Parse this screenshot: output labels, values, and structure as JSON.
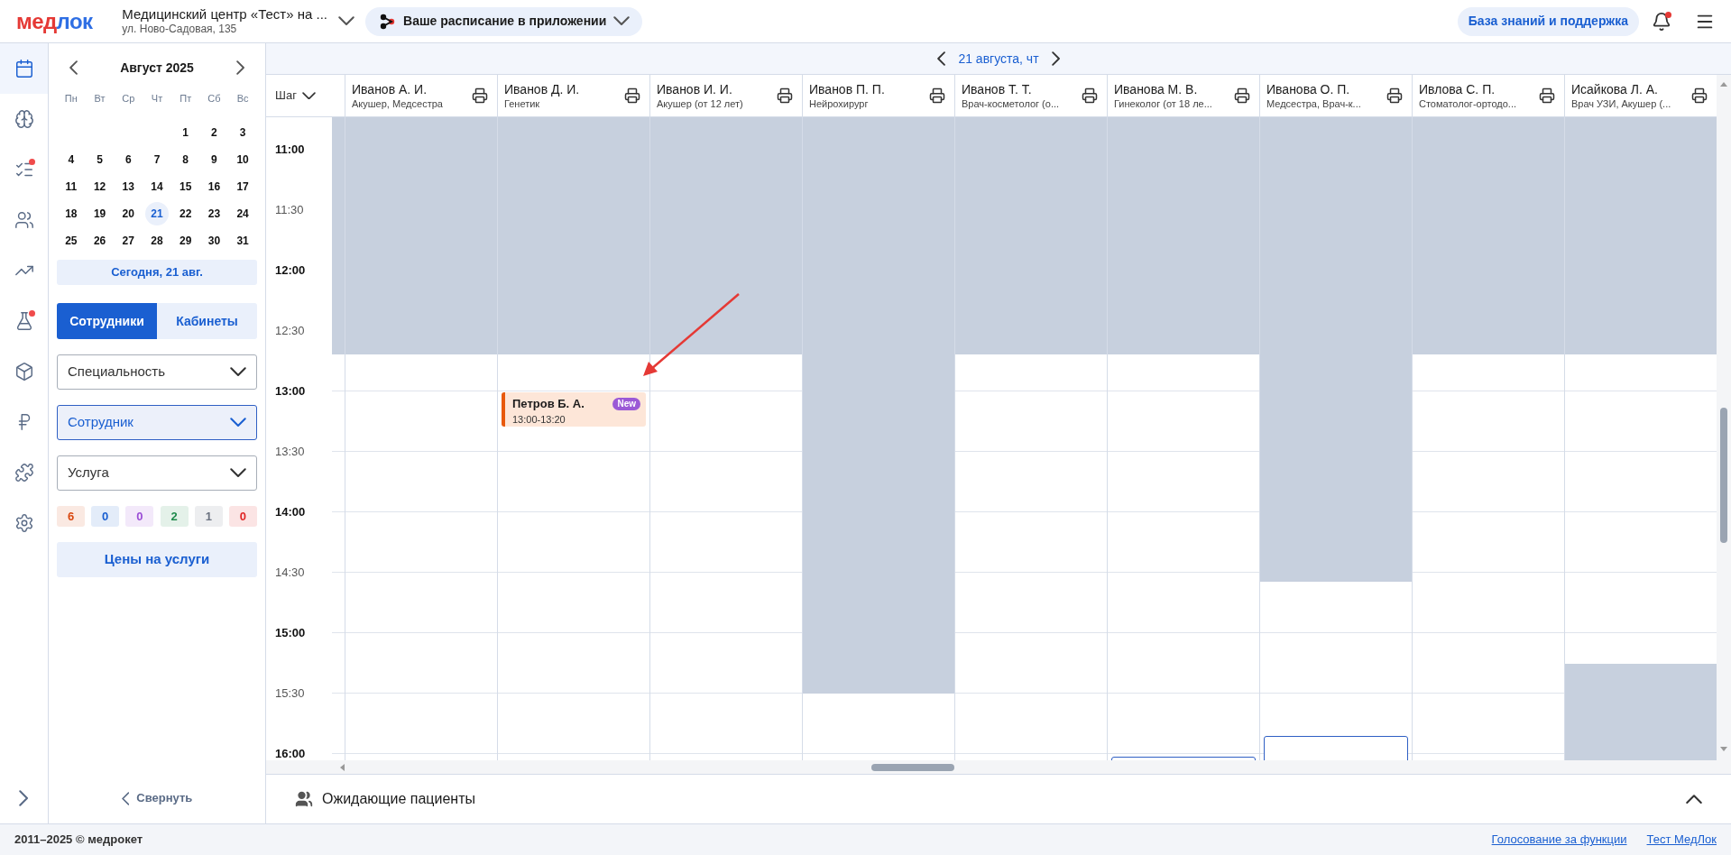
{
  "header": {
    "logo": {
      "part_1": "мед",
      "part_2": "лок"
    },
    "clinic": {
      "name": "Медицинский центр «Тест» на ...",
      "address": "ул. Ново-Садовая, 135"
    },
    "app_button": "Ваше расписание в приложении",
    "support_button": "База знаний и поддержка",
    "notifications": {
      "unread": true
    }
  },
  "nav_rail": {
    "items": [
      {
        "kind": "calendar",
        "selected": true,
        "badge": false
      },
      {
        "kind": "brain",
        "selected": false,
        "badge": false
      },
      {
        "kind": "checklist",
        "selected": false,
        "badge": true
      },
      {
        "kind": "users",
        "selected": false,
        "badge": false
      },
      {
        "kind": "chart",
        "selected": false,
        "badge": false
      },
      {
        "kind": "flask",
        "selected": false,
        "badge": true
      },
      {
        "kind": "box",
        "selected": false,
        "badge": false
      },
      {
        "kind": "ruble",
        "selected": false,
        "badge": false
      },
      {
        "kind": "puzzle",
        "selected": false,
        "badge": false
      },
      {
        "kind": "settings",
        "selected": false,
        "badge": false
      }
    ]
  },
  "calendar": {
    "month": "Август 2025",
    "weekdays": [
      "Пн",
      "Вт",
      "Ср",
      "Чт",
      "Пт",
      "Сб",
      "Вс"
    ],
    "weeks": [
      [
        {
          "day": "1",
          "selected": false
        },
        {
          "day": "2",
          "selected": false
        },
        {
          "day": "3",
          "selected": false
        }
      ],
      [
        {
          "day": "4",
          "selected": false
        },
        {
          "day": "5",
          "selected": false
        },
        {
          "day": "6",
          "selected": false
        },
        {
          "day": "7",
          "selected": false
        },
        {
          "day": "8",
          "selected": false
        },
        {
          "day": "9",
          "selected": false
        },
        {
          "day": "10",
          "selected": false
        }
      ],
      [
        {
          "day": "11",
          "selected": false
        },
        {
          "day": "12",
          "selected": false
        },
        {
          "day": "13",
          "selected": false
        },
        {
          "day": "14",
          "selected": false
        },
        {
          "day": "15",
          "selected": false
        },
        {
          "day": "16",
          "selected": false
        },
        {
          "day": "17",
          "selected": false
        }
      ],
      [
        {
          "day": "18",
          "selected": false
        },
        {
          "day": "19",
          "selected": false
        },
        {
          "day": "20",
          "selected": false
        },
        {
          "day": "21",
          "selected": true
        },
        {
          "day": "22",
          "selected": false
        },
        {
          "day": "23",
          "selected": false
        },
        {
          "day": "24",
          "selected": false
        }
      ],
      [
        {
          "day": "25",
          "selected": false
        },
        {
          "day": "26",
          "selected": false
        },
        {
          "day": "27",
          "selected": false
        },
        {
          "day": "28",
          "selected": false
        },
        {
          "day": "29",
          "selected": false
        },
        {
          "day": "30",
          "selected": false
        },
        {
          "day": "31",
          "selected": false
        }
      ]
    ],
    "today_button": "Сегодня, 21 авг."
  },
  "view_tabs": [
    {
      "label": "Сотрудники",
      "selected": true
    },
    {
      "label": "Кабинеты",
      "selected": false
    }
  ],
  "filters": [
    {
      "label": "Специальность",
      "active": false
    },
    {
      "label": "Сотрудник",
      "active": true
    },
    {
      "label": "Услуга",
      "active": false
    }
  ],
  "status_counts": [
    {
      "count": "6",
      "color": "#d9480f"
    },
    {
      "count": "0",
      "color": "#1a5fd1"
    },
    {
      "count": "0",
      "color": "#9b4dd6"
    },
    {
      "count": "2",
      "color": "#1f8a4c"
    },
    {
      "count": "1",
      "color": "#6b7280"
    },
    {
      "count": "0",
      "color": "#e02424"
    }
  ],
  "prices_button": "Цены на услуги",
  "collapse_button": "Свернуть",
  "schedule": {
    "date": "21 августа, чт",
    "step_label": "Шаг",
    "times": [
      {
        "label": "11:00",
        "kind": "hour"
      },
      {
        "label": "11:30",
        "kind": "half"
      },
      {
        "label": "12:00",
        "kind": "hour"
      },
      {
        "label": "12:30",
        "kind": "half"
      },
      {
        "label": "13:00",
        "kind": "hour"
      },
      {
        "label": "13:30",
        "kind": "half"
      },
      {
        "label": "14:00",
        "kind": "hour"
      },
      {
        "label": "14:30",
        "kind": "half"
      },
      {
        "label": "15:00",
        "kind": "hour"
      },
      {
        "label": "15:30",
        "kind": "half"
      },
      {
        "label": "16:00",
        "kind": "hour"
      }
    ],
    "partial_column": {
      "unavailable": [
        {
          "kind": "top",
          "level": 0.369
        }
      ]
    },
    "doctors": [
      {
        "name": "Иванов А. И.",
        "specialty": "Акушер, Медсестра",
        "unavailable": [
          {
            "kind": "top",
            "level": 0.369
          }
        ]
      },
      {
        "name": "Иванов Д. И.",
        "specialty": "Генетик",
        "unavailable": [
          {
            "kind": "top",
            "level": 0.369
          }
        ],
        "appointments": [
          {
            "kind": "visit",
            "patient": "Петров Б. А.",
            "time": "13:00-13:20",
            "badge": "New"
          }
        ]
      },
      {
        "name": "Иванов И. И.",
        "specialty": "Акушер (от 12 лет)",
        "unavailable": [
          {
            "kind": "top",
            "level": 0.369
          }
        ]
      },
      {
        "name": "Иванов П. П.",
        "specialty": "Нейрохирург",
        "unavailable": [
          {
            "kind": "top",
            "level": 0.896
          }
        ]
      },
      {
        "name": "Иванов Т. Т.",
        "specialty": "Врач-косметолог (о...",
        "unavailable": [
          {
            "kind": "top",
            "level": 0.369
          }
        ]
      },
      {
        "name": "Иванова М. В.",
        "specialty": "Гинеколог (от 18 ле...",
        "unavailable": [
          {
            "kind": "top",
            "level": 0.369
          }
        ],
        "appointments": [
          {
            "kind": "booked",
            "level": 0.006
          }
        ]
      },
      {
        "name": "Иванова О. П.",
        "specialty": "Медсестра, Врач-к...",
        "unavailable": [
          {
            "kind": "top",
            "level": 0.722
          }
        ],
        "appointments": [
          {
            "kind": "booked",
            "level": 0.038
          }
        ]
      },
      {
        "name": "Ивлова С. П.",
        "specialty": "Стоматолог-ортодо...",
        "unavailable": [
          {
            "kind": "top",
            "level": 0.369
          }
        ]
      },
      {
        "name": "Исайкова Л. А.",
        "specialty": "Врач УЗИ, Акушер (...",
        "unavailable": [
          {
            "kind": "top",
            "level": 0.369
          },
          {
            "kind": "bottom",
            "level": 0.15
          }
        ]
      }
    ]
  },
  "waiting_patients": {
    "label": "Ожидающие пациенты",
    "expanded": false
  },
  "footer": {
    "copyright": "2011–2025 © медрокет",
    "links": [
      "Голосование за функции",
      "Тест МедЛок"
    ]
  }
}
